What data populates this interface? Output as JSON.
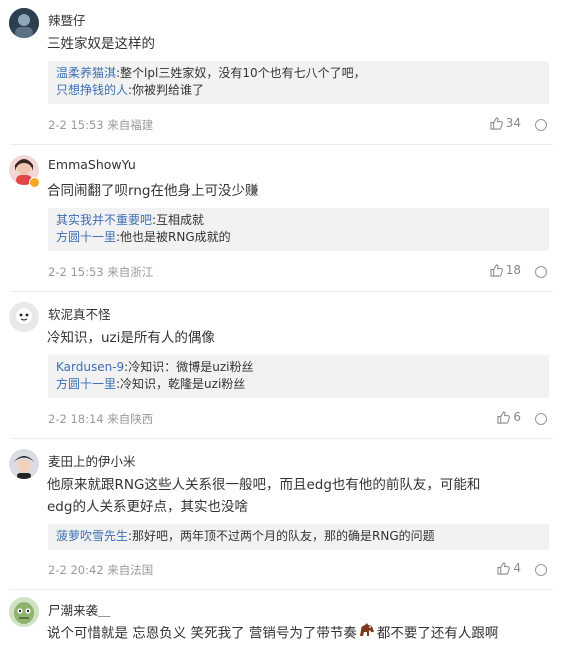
{
  "comments": [
    {
      "user": "辣暨仔",
      "text": "三姓家奴是这样的",
      "replies": [
        {
          "name": "温柔养猫淇",
          "text": ":整个lpl三姓家奴，没有10个也有七八个了吧，"
        },
        {
          "name": "只想挣钱的人",
          "text": ":你被判给谁了"
        }
      ],
      "meta": "2-2 15:53 来自福建",
      "likes": "34"
    },
    {
      "user": "EmmaShowYu",
      "text": "合同闹翻了呗rng在他身上可没少赚",
      "replies": [
        {
          "name": "其实我并不重要吧",
          "text": ":互相成就"
        },
        {
          "name": "方圆十一里",
          "text": ":他也是被RNG成就的"
        }
      ],
      "meta": "2-2 15:53 来自浙江",
      "likes": "18"
    },
    {
      "user": "软泥真不怪",
      "text": "冷知识，uzi是所有人的偶像",
      "replies": [
        {
          "name": "Kardusen-9",
          "text": ":冷知识：微博是uzi粉丝"
        },
        {
          "name": "方圆十一里",
          "text": ":冷知识，乾隆是uzi粉丝"
        }
      ],
      "meta": "2-2 18:14 来自陕西",
      "likes": "6"
    },
    {
      "user": "麦田上的伊小米",
      "text_line1": "他原来就跟RNG这些人关系很一般吧，而且edg也有他的前队友，可能和",
      "text_line2": "edg的人关系更好点，其实也没啥",
      "replies": [
        {
          "name": "菠萝吹雪先生",
          "text": ":那好吧，两年顶不过两个月的队友，那的确是RNG的问题"
        }
      ],
      "meta": "2-2 20:42 来自法国",
      "likes": "4"
    },
    {
      "user": "尸潮来袭＿",
      "text_before": "说个可惜就是 忘恩负义 笑死我了 营销号为了带节奏",
      "text_after": "都不要了还有人跟啊"
    }
  ],
  "colors": {
    "reply_name_orange": "#eb7350",
    "reply_name_blue": "#3d6fb5",
    "meta": "#999999",
    "reply_bg": "#f2f2f2"
  },
  "icons": [
    "thumbs-up-icon",
    "more-options-icon",
    "horse-emoji-icon"
  ]
}
